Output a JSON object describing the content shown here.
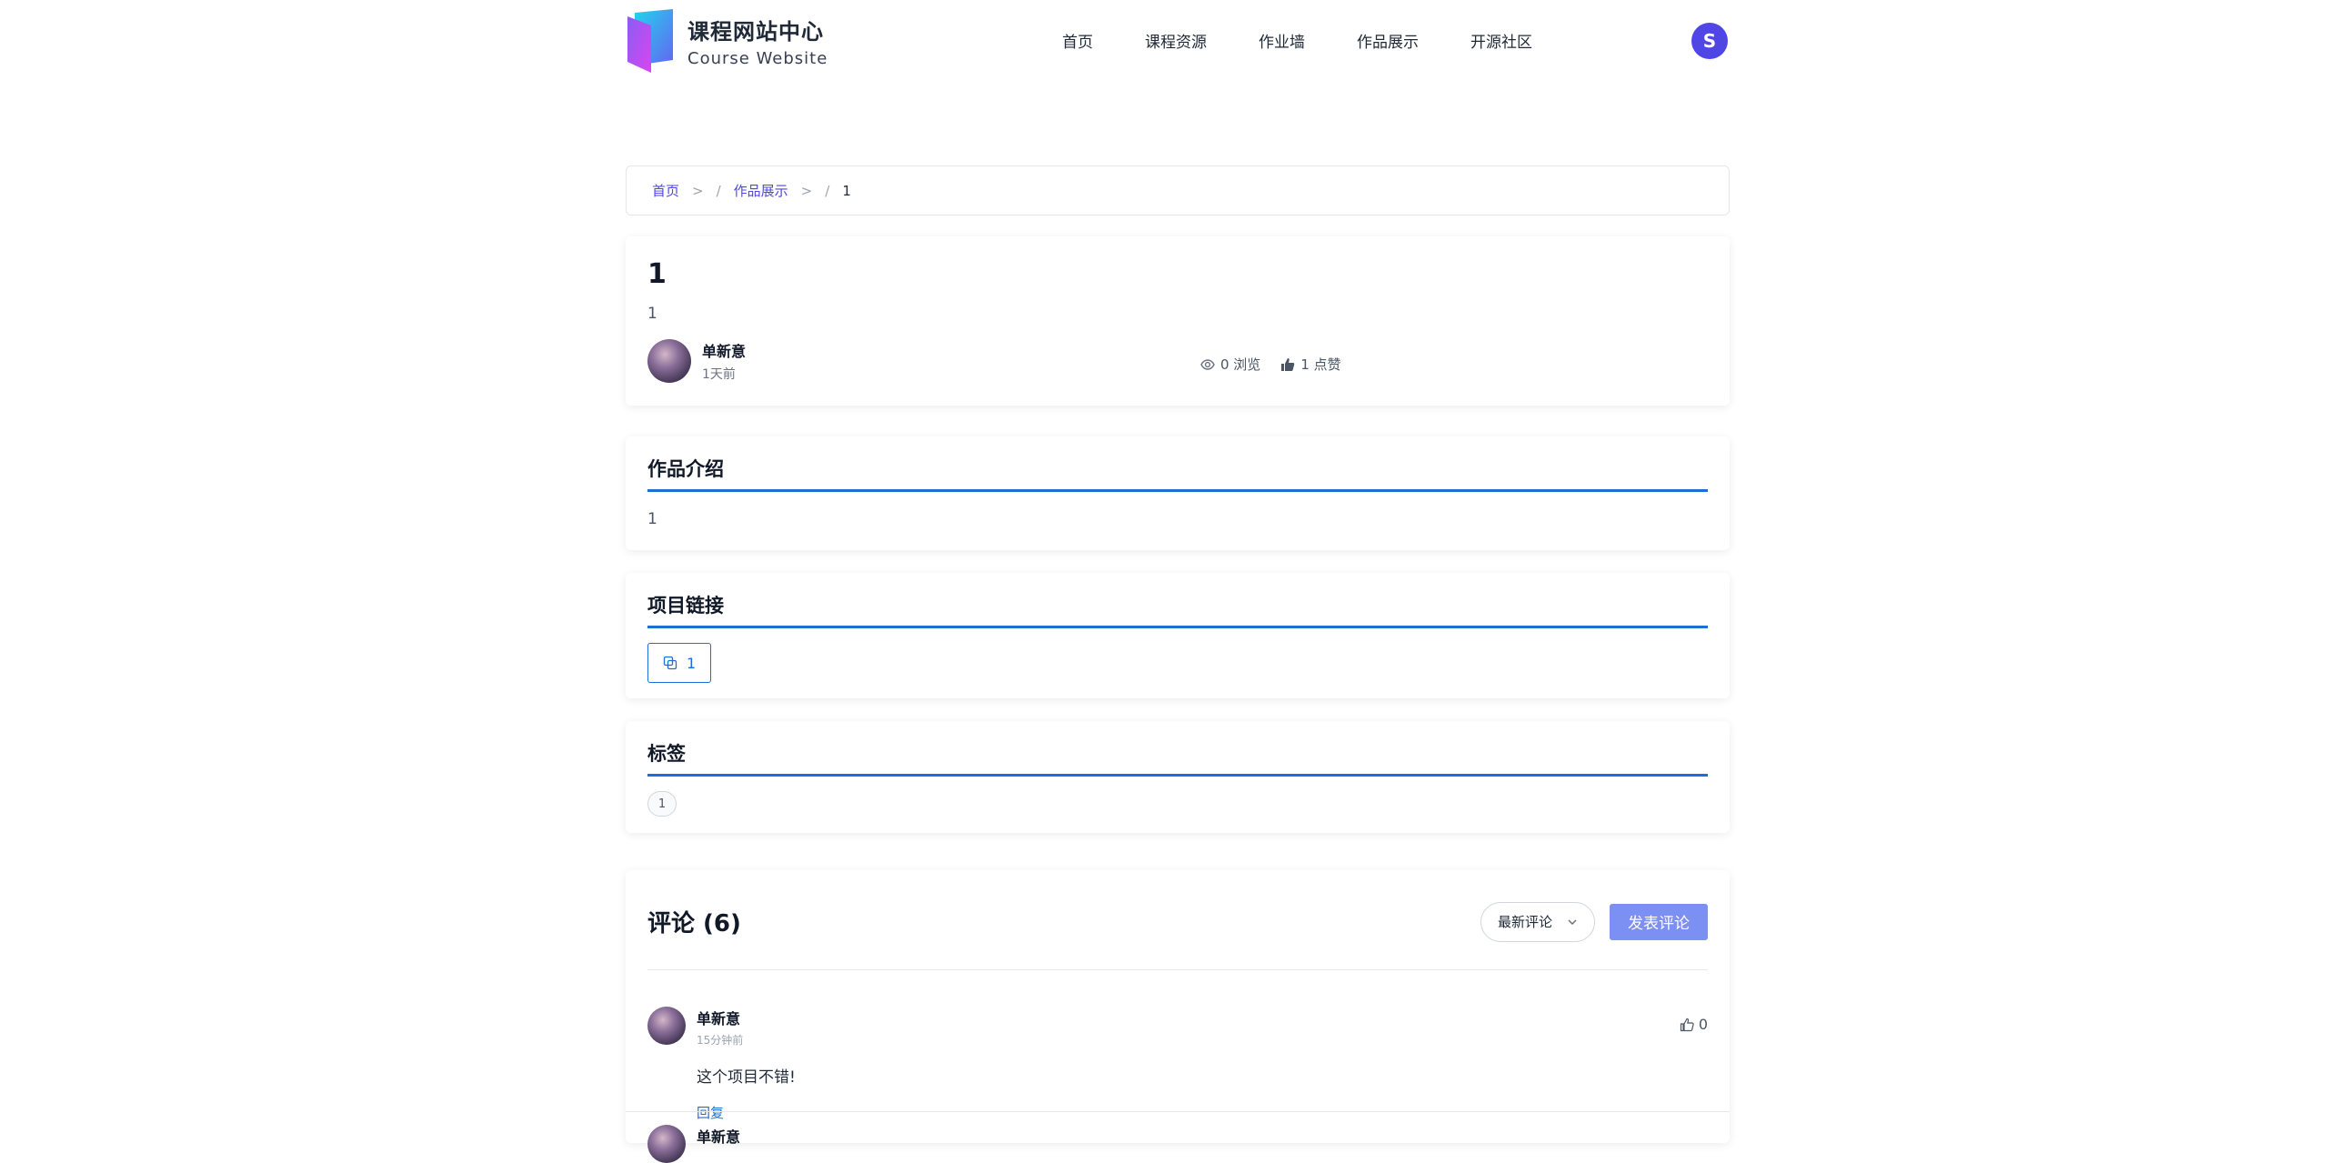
{
  "header": {
    "logo_title": "课程网站中心",
    "logo_sub": "Course Website",
    "nav": [
      "首页",
      "课程资源",
      "作业墙",
      "作品展示",
      "开源社区"
    ],
    "user_initial": "S"
  },
  "breadcrumb": {
    "home": "首页",
    "section": "作品展示",
    "current": "1",
    "sep1": ">",
    "slash": "/"
  },
  "work": {
    "title": "1",
    "description": "1",
    "author": "单新意",
    "time": "1天前",
    "views": "0 浏览",
    "likes": "1 点赞"
  },
  "intro": {
    "title": "作品介绍",
    "body": "1"
  },
  "links": {
    "title": "项目链接",
    "link_label": "1"
  },
  "tags": {
    "title": "标签",
    "items": [
      "1"
    ]
  },
  "comments": {
    "title": "评论 (6)",
    "sort_label": "最新评论",
    "post_label": "发表评论",
    "items": [
      {
        "author": "单新意",
        "time": "15分钟前",
        "text": "这个项目不错!",
        "reply": "回复",
        "likes": "0"
      },
      {
        "author": "单新意"
      }
    ]
  },
  "colors": {
    "accent": "#4f46e5",
    "link_blue": "#1d6fd6",
    "post_button": "#7c8ff3"
  }
}
